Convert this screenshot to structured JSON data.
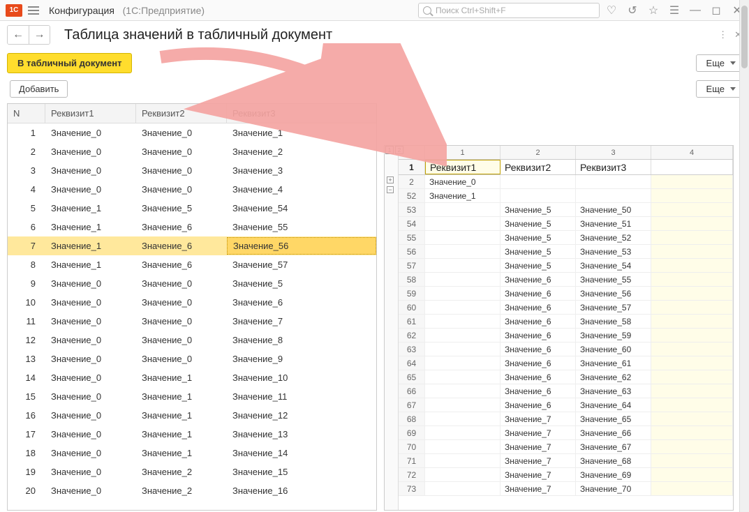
{
  "titlebar": {
    "app": "Конфигурация",
    "paren": "(1С:Предприятие)",
    "search_placeholder": "Поиск Ctrl+Shift+F"
  },
  "subhead": {
    "title": "Таблица значений в табличный документ"
  },
  "buttons": {
    "to_doc": "В табличный документ",
    "more": "Еще",
    "add": "Добавить"
  },
  "left_table": {
    "headers": {
      "n": "N",
      "c1": "Реквизит1",
      "c2": "Реквизит2",
      "c3": "Реквизит3"
    },
    "selected_index": 6,
    "rows": [
      {
        "n": 1,
        "c1": "Значение_0",
        "c2": "Значение_0",
        "c3": "Значение_1"
      },
      {
        "n": 2,
        "c1": "Значение_0",
        "c2": "Значение_0",
        "c3": "Значение_2"
      },
      {
        "n": 3,
        "c1": "Значение_0",
        "c2": "Значение_0",
        "c3": "Значение_3"
      },
      {
        "n": 4,
        "c1": "Значение_0",
        "c2": "Значение_0",
        "c3": "Значение_4"
      },
      {
        "n": 5,
        "c1": "Значение_1",
        "c2": "Значение_5",
        "c3": "Значение_54"
      },
      {
        "n": 6,
        "c1": "Значение_1",
        "c2": "Значение_6",
        "c3": "Значение_55"
      },
      {
        "n": 7,
        "c1": "Значение_1",
        "c2": "Значение_6",
        "c3": "Значение_56"
      },
      {
        "n": 8,
        "c1": "Значение_1",
        "c2": "Значение_6",
        "c3": "Значение_57"
      },
      {
        "n": 9,
        "c1": "Значение_0",
        "c2": "Значение_0",
        "c3": "Значение_5"
      },
      {
        "n": 10,
        "c1": "Значение_0",
        "c2": "Значение_0",
        "c3": "Значение_6"
      },
      {
        "n": 11,
        "c1": "Значение_0",
        "c2": "Значение_0",
        "c3": "Значение_7"
      },
      {
        "n": 12,
        "c1": "Значение_0",
        "c2": "Значение_0",
        "c3": "Значение_8"
      },
      {
        "n": 13,
        "c1": "Значение_0",
        "c2": "Значение_0",
        "c3": "Значение_9"
      },
      {
        "n": 14,
        "c1": "Значение_0",
        "c2": "Значение_1",
        "c3": "Значение_10"
      },
      {
        "n": 15,
        "c1": "Значение_0",
        "c2": "Значение_1",
        "c3": "Значение_11"
      },
      {
        "n": 16,
        "c1": "Значение_0",
        "c2": "Значение_1",
        "c3": "Значение_12"
      },
      {
        "n": 17,
        "c1": "Значение_0",
        "c2": "Значение_1",
        "c3": "Значение_13"
      },
      {
        "n": 18,
        "c1": "Значение_0",
        "c2": "Значение_1",
        "c3": "Значение_14"
      },
      {
        "n": 19,
        "c1": "Значение_0",
        "c2": "Значение_2",
        "c3": "Значение_15"
      },
      {
        "n": 20,
        "c1": "Значение_0",
        "c2": "Значение_2",
        "c3": "Значение_16"
      }
    ]
  },
  "spreadsheet": {
    "col_nums": [
      "1",
      "2",
      "3",
      "4"
    ],
    "headers": [
      "Реквизит1",
      "Реквизит2",
      "Реквизит3"
    ],
    "header_row_num": "1",
    "rows": [
      {
        "r": "2",
        "c1": "Значение_0",
        "c2": "",
        "c3": ""
      },
      {
        "r": "52",
        "c1": "Значение_1",
        "c2": "",
        "c3": ""
      },
      {
        "r": "53",
        "c1": "",
        "c2": "Значение_5",
        "c3": "Значение_50"
      },
      {
        "r": "54",
        "c1": "",
        "c2": "Значение_5",
        "c3": "Значение_51"
      },
      {
        "r": "55",
        "c1": "",
        "c2": "Значение_5",
        "c3": "Значение_52"
      },
      {
        "r": "56",
        "c1": "",
        "c2": "Значение_5",
        "c3": "Значение_53"
      },
      {
        "r": "57",
        "c1": "",
        "c2": "Значение_5",
        "c3": "Значение_54"
      },
      {
        "r": "58",
        "c1": "",
        "c2": "Значение_6",
        "c3": "Значение_55"
      },
      {
        "r": "59",
        "c1": "",
        "c2": "Значение_6",
        "c3": "Значение_56"
      },
      {
        "r": "60",
        "c1": "",
        "c2": "Значение_6",
        "c3": "Значение_57"
      },
      {
        "r": "61",
        "c1": "",
        "c2": "Значение_6",
        "c3": "Значение_58"
      },
      {
        "r": "62",
        "c1": "",
        "c2": "Значение_6",
        "c3": "Значение_59"
      },
      {
        "r": "63",
        "c1": "",
        "c2": "Значение_6",
        "c3": "Значение_60"
      },
      {
        "r": "64",
        "c1": "",
        "c2": "Значение_6",
        "c3": "Значение_61"
      },
      {
        "r": "65",
        "c1": "",
        "c2": "Значение_6",
        "c3": "Значение_62"
      },
      {
        "r": "66",
        "c1": "",
        "c2": "Значение_6",
        "c3": "Значение_63"
      },
      {
        "r": "67",
        "c1": "",
        "c2": "Значение_6",
        "c3": "Значение_64"
      },
      {
        "r": "68",
        "c1": "",
        "c2": "Значение_7",
        "c3": "Значение_65"
      },
      {
        "r": "69",
        "c1": "",
        "c2": "Значение_7",
        "c3": "Значение_66"
      },
      {
        "r": "70",
        "c1": "",
        "c2": "Значение_7",
        "c3": "Значение_67"
      },
      {
        "r": "71",
        "c1": "",
        "c2": "Значение_7",
        "c3": "Значение_68"
      },
      {
        "r": "72",
        "c1": "",
        "c2": "Значение_7",
        "c3": "Значение_69"
      },
      {
        "r": "73",
        "c1": "",
        "c2": "Значение_7",
        "c3": "Значение_70"
      }
    ]
  }
}
